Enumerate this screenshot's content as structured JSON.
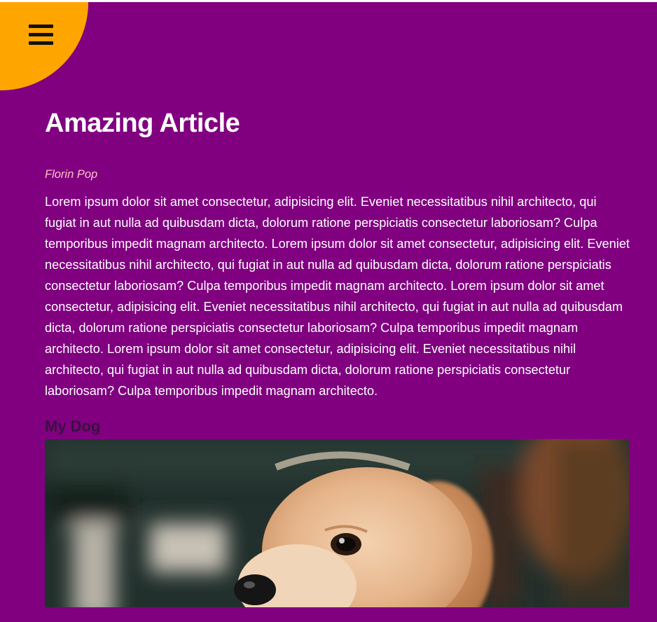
{
  "header": {
    "menu_icon": "hamburger-menu-icon",
    "accent_color": "#ffa500"
  },
  "article": {
    "title": "Amazing Article",
    "author": "Florin Pop",
    "body": "Lorem ipsum dolor sit amet consectetur, adipisicing elit. Eveniet necessitatibus nihil architecto, qui fugiat in aut nulla ad quibusdam dicta, dolorum ratione perspiciatis consectetur laboriosam? Culpa temporibus impedit magnam architecto. Lorem ipsum dolor sit amet consectetur, adipisicing elit. Eveniet necessitatibus nihil architecto, qui fugiat in aut nulla ad quibusdam dicta, dolorum ratione perspiciatis consectetur laboriosam? Culpa temporibus impedit magnam architecto. Lorem ipsum dolor sit amet consectetur, adipisicing elit. Eveniet necessitatibus nihil architecto, qui fugiat in aut nulla ad quibusdam dicta, dolorum ratione perspiciatis consectetur laboriosam? Culpa temporibus impedit magnam architecto. Lorem ipsum dolor sit amet consectetur, adipisicing elit. Eveniet necessitatibus nihil architecto, qui fugiat in aut nulla ad quibusdam dicta, dolorum ratione perspiciatis consectetur laboriosam? Culpa temporibus impedit magnam architecto.",
    "section_heading": "My Dog"
  },
  "colors": {
    "page_background": "#800080",
    "author_color": "#ffc0cb",
    "text_color": "#ffffff"
  }
}
